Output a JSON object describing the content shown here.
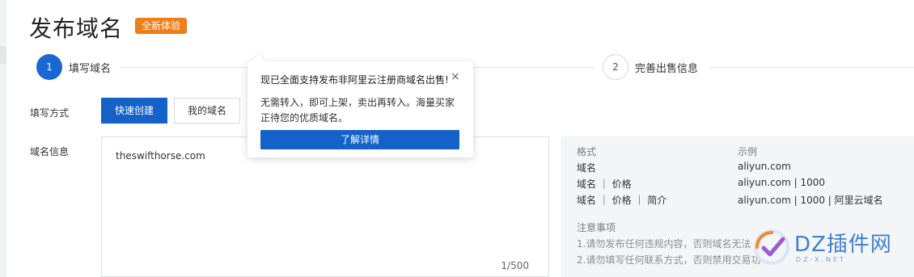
{
  "page": {
    "title": "发布域名",
    "badge": "全新体验"
  },
  "steps": [
    {
      "number": "1",
      "label": "填写域名",
      "active": true
    },
    {
      "number": "2",
      "label": "完善出售信息",
      "active": false
    }
  ],
  "form": {
    "method_label": "填写方式",
    "method_options": [
      "快速创建",
      "我的域名"
    ],
    "domain_label": "域名信息",
    "textarea_value": "theswifthorse.com",
    "char_count": "1/500"
  },
  "format_panel": {
    "format_header": "格式",
    "example_header": "示例",
    "rows": [
      {
        "format": "域名",
        "example": "aliyun.com"
      },
      {
        "format": "域名 ｜ 价格",
        "example": "aliyun.com | 1000"
      },
      {
        "format": "域名 ｜ 价格 ｜ 简介",
        "example": "aliyun.com | 1000 | 阿里云域名"
      }
    ],
    "notes_title": "注意事项",
    "notes": [
      "1.请勿发布任何违规内容，否则域名无法",
      "2.请勿填写任何联系方式，否则禁用交易功"
    ]
  },
  "popover": {
    "title": "现已全面支持发布非阿里云注册商域名出售!",
    "body": "无需转入，即可上架，卖出再转入。海量买家正待您的优质域名。",
    "button": "了解详情",
    "close": "×"
  },
  "watermark": {
    "text": "DZ插件网",
    "sub": "DZ-X.NET"
  },
  "colors": {
    "primary": "#1462c8",
    "badge": "#ef7e1a",
    "panel_bg": "#f4f5f7"
  }
}
